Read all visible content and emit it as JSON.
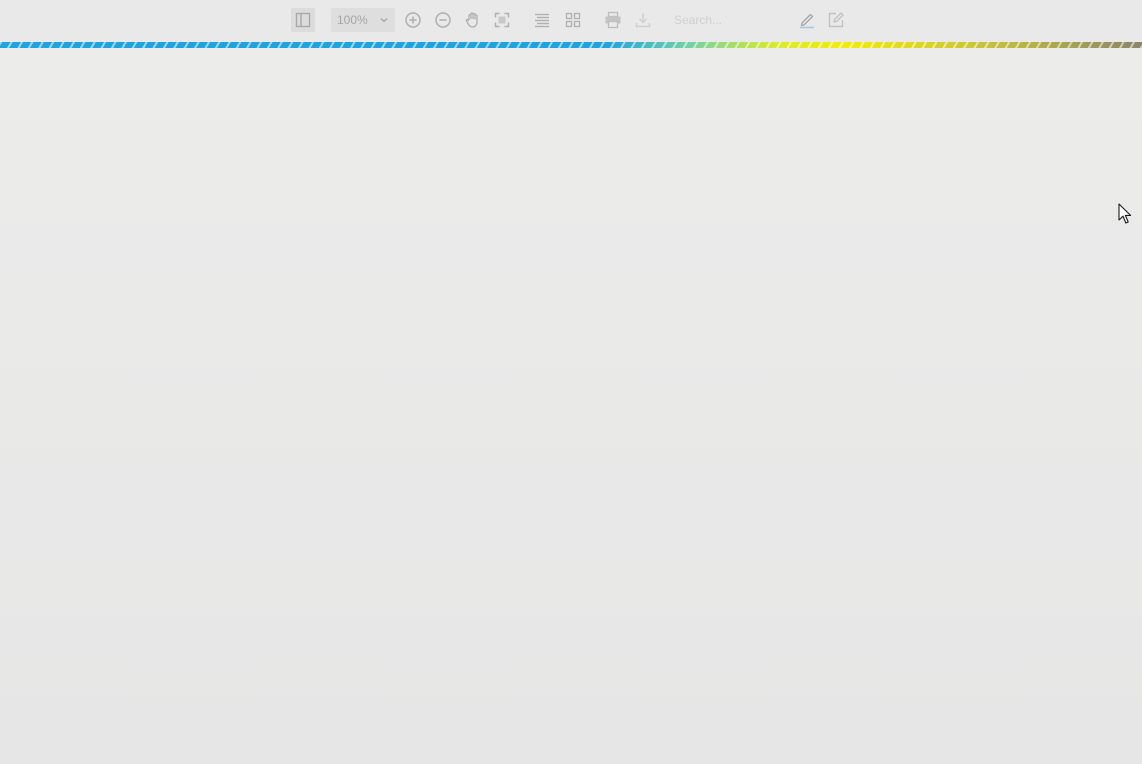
{
  "toolbar": {
    "sidebar_toggle_icon": "sidebar-toggle-icon",
    "zoom": {
      "value": "100%",
      "chevron_icon": "chevron-down-icon"
    },
    "zoom_in_icon": "zoom-in-icon",
    "zoom_out_icon": "zoom-out-icon",
    "pan_icon": "hand-pan-icon",
    "fullscreen_icon": "fullscreen-icon",
    "single_page_icon": "single-page-view-icon",
    "grid_view_icon": "grid-view-icon",
    "print_icon": "print-icon",
    "download_icon": "download-icon",
    "search": {
      "placeholder": "Search...",
      "value": ""
    },
    "highlight_icon": "highlighter-icon",
    "annotate_icon": "edit-note-icon"
  },
  "loading_bar": {
    "colors": [
      "#1fa3de",
      "#6fd0a8",
      "#f4ea0a",
      "#8a8568"
    ]
  },
  "colors": {
    "toolbar_bg": "#e9e9e9",
    "viewer_bg": "#e6e6e6",
    "icon_color": "#b4b4b4",
    "accent": "#1fa3de"
  }
}
